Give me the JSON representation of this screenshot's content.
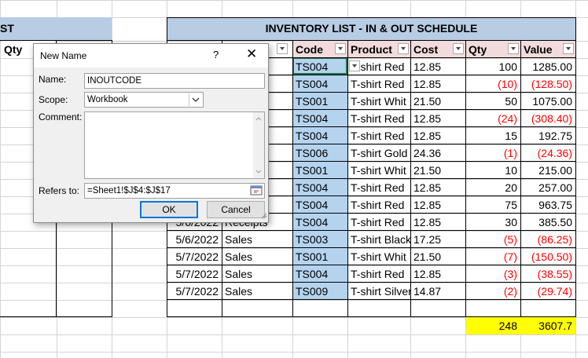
{
  "left_table": {
    "banner_text": "ST",
    "qty_header": "Qty"
  },
  "right_table": {
    "banner_text": "INVENTORY LIST - IN & OUT SCHEDULE",
    "headers": [
      "Code",
      "Product",
      "Cost",
      "Qty",
      "Value"
    ],
    "rows": [
      {
        "date": "",
        "type": "",
        "code": "TS004",
        "product": "T-shirt Red",
        "cost": "12.85",
        "qty": "100",
        "value": "1285.00",
        "neg": false
      },
      {
        "date": "",
        "type": "",
        "code": "TS004",
        "product": "T-shirt Red",
        "cost": "12.85",
        "qty": "(10)",
        "value": "(128.50)",
        "neg": true
      },
      {
        "date": "",
        "type": "",
        "code": "TS001",
        "product": "T-shirt Whit",
        "cost": "21.50",
        "qty": "50",
        "value": "1075.00",
        "neg": false
      },
      {
        "date": "",
        "type": "",
        "code": "TS004",
        "product": "T-shirt Red",
        "cost": "12.85",
        "qty": "(24)",
        "value": "(308.40)",
        "neg": true
      },
      {
        "date": "",
        "type": "",
        "code": "TS004",
        "product": "T-shirt Red",
        "cost": "12.85",
        "qty": "15",
        "value": "192.75",
        "neg": false
      },
      {
        "date": "",
        "type": "",
        "code": "TS006",
        "product": "T-shirt Gold",
        "cost": "24.36",
        "qty": "(1)",
        "value": "(24.36)",
        "neg": true
      },
      {
        "date": "",
        "type": "",
        "code": "TS001",
        "product": "T-shirt Whit",
        "cost": "21.50",
        "qty": "10",
        "value": "215.00",
        "neg": false
      },
      {
        "date": "",
        "type": "",
        "code": "TS004",
        "product": "T-shirt Red",
        "cost": "12.85",
        "qty": "20",
        "value": "257.00",
        "neg": false
      },
      {
        "date": "",
        "type": "",
        "code": "TS004",
        "product": "T-shirt Red",
        "cost": "12.85",
        "qty": "75",
        "value": "963.75",
        "neg": false
      },
      {
        "date": "5/6/2022",
        "type": "Receipts",
        "code": "TS004",
        "product": "T-shirt Red",
        "cost": "12.85",
        "qty": "30",
        "value": "385.50",
        "neg": false
      },
      {
        "date": "5/6/2022",
        "type": "Sales",
        "code": "TS003",
        "product": "T-shirt Black",
        "cost": "17.25",
        "qty": "(5)",
        "value": "(86.25)",
        "neg": true
      },
      {
        "date": "5/7/2022",
        "type": "Sales",
        "code": "TS001",
        "product": "T-shirt Whit",
        "cost": "21.50",
        "qty": "(7)",
        "value": "(150.50)",
        "neg": true
      },
      {
        "date": "5/7/2022",
        "type": "Sales",
        "code": "TS004",
        "product": "T-shirt Red",
        "cost": "12.85",
        "qty": "(3)",
        "value": "(38.55)",
        "neg": true
      },
      {
        "date": "5/7/2022",
        "type": "Sales",
        "code": "TS009",
        "product": "T-shirt Silver",
        "cost": "14.87",
        "qty": "(2)",
        "value": "(29.74)",
        "neg": true
      }
    ],
    "totals": {
      "qty": "248",
      "value": "3607.7"
    }
  },
  "dialog": {
    "title": "New Name",
    "help_label": "?",
    "close_label": "✕",
    "name_label": "Name:",
    "name_value": "INOUTCODE",
    "scope_label": "Scope:",
    "scope_value": "Workbook",
    "comment_label": "Comment:",
    "refers_label": "Refers to:",
    "refers_value": "=Sheet1!$J$4:$J$17",
    "ok_label": "OK",
    "cancel_label": "Cancel"
  },
  "colors": {
    "banner": "#b8cce4",
    "header": "#f2dcdb",
    "selection": "#b4d3ef",
    "negative": "#ff0000",
    "totals": "#ffff00"
  },
  "icons": [
    "dropdown-arrow-icon",
    "chevron-down-icon",
    "collapse-range-icon",
    "resize-grip-icon"
  ]
}
